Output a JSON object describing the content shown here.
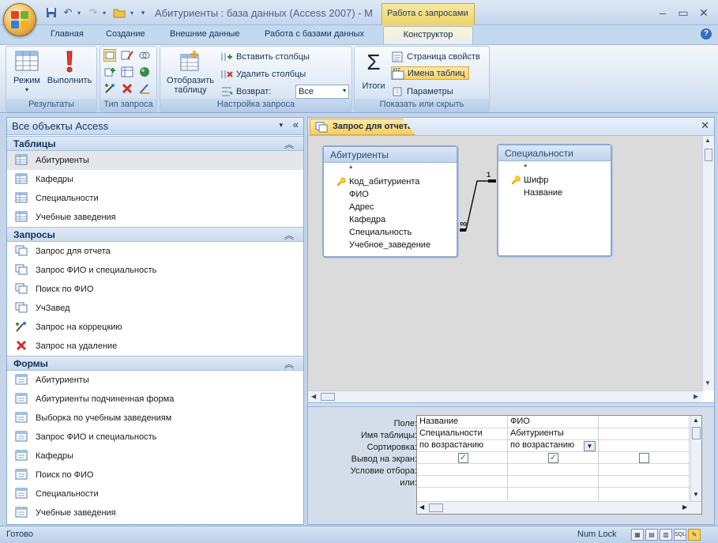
{
  "window": {
    "title": "Абитуриенты : база данных (Access 2007) - M",
    "context_title": "Работа с запросами"
  },
  "tabs": [
    "Главная",
    "Создание",
    "Внешние данные",
    "Работа с базами данных",
    "Конструктор"
  ],
  "ribbon": {
    "results": {
      "label": "Результаты",
      "view": "Режим",
      "run": "Выполнить"
    },
    "query_type": {
      "label": "Тип запроса"
    },
    "setup": {
      "label": "Настройка запроса",
      "show_table": "Отобразить таблицу",
      "insert_cols": "Вставить столбцы",
      "delete_cols": "Удалить столбцы",
      "return_label": "Возврат:",
      "return_value": "Все"
    },
    "show_hide": {
      "label": "Показать или скрыть",
      "totals": "Итоги",
      "props": "Страница свойств",
      "table_names": "Имена таблиц",
      "params": "Параметры"
    }
  },
  "nav": {
    "header": "Все объекты Access",
    "groups": [
      {
        "title": "Таблицы",
        "items": [
          "Абитуриенты",
          "Кафедры",
          "Специальности",
          "Учебные заведения"
        ]
      },
      {
        "title": "Запросы",
        "items": [
          "Запрос для отчета",
          "Запрос ФИО и специальность",
          "Поиск по ФИО",
          "УчЗавед",
          "Запрос на коррецкию",
          "Запрос на удаление"
        ]
      },
      {
        "title": "Формы",
        "items": [
          "Абитуриенты",
          "Абитуриенты подчиненная форма",
          "Выборка по учебным заведениям",
          "Запрос ФИО и специальность",
          "Кафедры",
          "Поиск по ФИО",
          "Специальности",
          "Учебные заведения"
        ]
      }
    ]
  },
  "query": {
    "tab_title": "Запрос для отчета",
    "tables": [
      {
        "name": "Абитуриенты",
        "fields": [
          "*",
          "Код_абитуриента",
          "ФИО",
          "Адрес",
          "Кафедра",
          "Специальность",
          "Учебное_заведение"
        ],
        "key_field": "Код_абитуриента"
      },
      {
        "name": "Специальности",
        "fields": [
          "*",
          "Шифр",
          "Название"
        ],
        "key_field": "Шифр"
      }
    ],
    "relation": {
      "one": "1",
      "many": "∞"
    },
    "row_labels": [
      "Поле:",
      "Имя таблицы:",
      "Сортировка:",
      "Вывод на экран:",
      "Условие отбора:",
      "или:"
    ],
    "columns": [
      {
        "field": "Название",
        "table": "Специальности",
        "sort": "по возрастанию",
        "show": true
      },
      {
        "field": "ФИО",
        "table": "Абитуриенты",
        "sort": "по возрастанию",
        "show": true
      },
      {
        "field": "",
        "table": "",
        "sort": "",
        "show": false
      }
    ]
  },
  "status": {
    "left": "Готово",
    "numlock": "Num Lock"
  }
}
